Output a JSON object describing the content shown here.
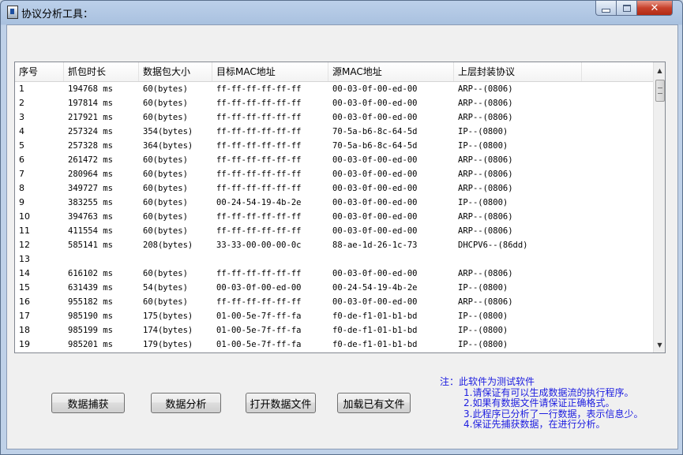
{
  "window": {
    "title": "协议分析工具："
  },
  "table": {
    "columns": [
      "序号",
      "抓包时长",
      "数据包大小",
      "目标MAC地址",
      "源MAC地址",
      "上层封装协议"
    ],
    "rows": [
      [
        "1",
        "194768 ms",
        "60(bytes)",
        "ff-ff-ff-ff-ff-ff",
        "00-03-0f-00-ed-00",
        "ARP--(0806)"
      ],
      [
        "2",
        "197814 ms",
        "60(bytes)",
        "ff-ff-ff-ff-ff-ff",
        "00-03-0f-00-ed-00",
        "ARP--(0806)"
      ],
      [
        "3",
        "217921 ms",
        "60(bytes)",
        "ff-ff-ff-ff-ff-ff",
        "00-03-0f-00-ed-00",
        "ARP--(0806)"
      ],
      [
        "4",
        "257324 ms",
        "354(bytes)",
        "ff-ff-ff-ff-ff-ff",
        "70-5a-b6-8c-64-5d",
        "IP--(0800)"
      ],
      [
        "5",
        "257328 ms",
        "364(bytes)",
        "ff-ff-ff-ff-ff-ff",
        "70-5a-b6-8c-64-5d",
        "IP--(0800)"
      ],
      [
        "6",
        "261472 ms",
        "60(bytes)",
        "ff-ff-ff-ff-ff-ff",
        "00-03-0f-00-ed-00",
        "ARP--(0806)"
      ],
      [
        "7",
        "280964 ms",
        "60(bytes)",
        "ff-ff-ff-ff-ff-ff",
        "00-03-0f-00-ed-00",
        "ARP--(0806)"
      ],
      [
        "8",
        "349727 ms",
        "60(bytes)",
        "ff-ff-ff-ff-ff-ff",
        "00-03-0f-00-ed-00",
        "ARP--(0806)"
      ],
      [
        "9",
        "383255 ms",
        "60(bytes)",
        "00-24-54-19-4b-2e",
        "00-03-0f-00-ed-00",
        "IP--(0800)"
      ],
      [
        "10",
        "394763 ms",
        "60(bytes)",
        "ff-ff-ff-ff-ff-ff",
        "00-03-0f-00-ed-00",
        "ARP--(0806)"
      ],
      [
        "11",
        "411554 ms",
        "60(bytes)",
        "ff-ff-ff-ff-ff-ff",
        "00-03-0f-00-ed-00",
        "ARP--(0806)"
      ],
      [
        "12",
        "585141 ms",
        "208(bytes)",
        "33-33-00-00-00-0c",
        "88-ae-1d-26-1c-73",
        "DHCPV6--(86dd)"
      ],
      [
        "13",
        "",
        "",
        "",
        "",
        ""
      ],
      [
        "14",
        "616102 ms",
        "60(bytes)",
        "ff-ff-ff-ff-ff-ff",
        "00-03-0f-00-ed-00",
        "ARP--(0806)"
      ],
      [
        "15",
        "631439 ms",
        "54(bytes)",
        "00-03-0f-00-ed-00",
        "00-24-54-19-4b-2e",
        "IP--(0800)"
      ],
      [
        "16",
        "955182 ms",
        "60(bytes)",
        "ff-ff-ff-ff-ff-ff",
        "00-03-0f-00-ed-00",
        "ARP--(0806)"
      ],
      [
        "17",
        "985190 ms",
        "175(bytes)",
        "01-00-5e-7f-ff-fa",
        "f0-de-f1-01-b1-bd",
        "IP--(0800)"
      ],
      [
        "18",
        "985199 ms",
        "174(bytes)",
        "01-00-5e-7f-ff-fa",
        "f0-de-f1-01-b1-bd",
        "IP--(0800)"
      ],
      [
        "19",
        "985201 ms",
        "179(bytes)",
        "01-00-5e-7f-ff-fa",
        "f0-de-f1-01-b1-bd",
        "IP--(0800)"
      ]
    ]
  },
  "buttons": {
    "capture": "数据捕获",
    "analyze": "数据分析",
    "open_file": "打开数据文件",
    "load_file": "加载已有文件"
  },
  "notes": {
    "title": "注：此软件为测试软件",
    "items": [
      "1.请保证有可以生成数据流的执行程序。",
      "2.如果有数据文件请保证正确格式。",
      "3.此程序已分析了一行数据，表示信息少。",
      "4.保证先捕获数据，在进行分析。"
    ]
  },
  "icons": {
    "app": "app-icon",
    "minimize": "minimize-icon",
    "maximize": "maximize-icon",
    "close": "close-icon",
    "scroll_up": "scroll-up-arrow-icon",
    "scroll_down": "scroll-down-arrow-icon"
  },
  "colors": {
    "note_text": "#1c1ce0",
    "close_button": "#c7412c"
  }
}
